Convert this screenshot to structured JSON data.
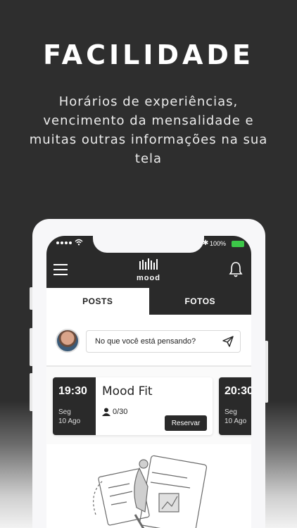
{
  "promo": {
    "headline": "FACILIDADE",
    "subtitle": "Horários de experiências, vencimento da mensalidade e muitas outras informações na sua tela"
  },
  "statusbar": {
    "battery_text": "100%",
    "battery_color": "#3cc748"
  },
  "appbar": {
    "logo_text": "mood",
    "menu_icon": "hamburger-icon",
    "notification_icon": "bell-icon"
  },
  "tabs": [
    {
      "label": "POSTS",
      "active": true
    },
    {
      "label": "FOTOS",
      "active": false
    }
  ],
  "composer": {
    "placeholder": "No que você está pensando?",
    "send_icon": "send-icon"
  },
  "classes": [
    {
      "time": "19:30",
      "day": "Seg",
      "date": "10 Ago",
      "name": "Mood Fit",
      "capacity": "0/30",
      "action": "Reservar"
    },
    {
      "time": "20:30",
      "day": "Seg",
      "date": "10 Ago"
    }
  ],
  "colors": {
    "dark": "#2a2a2a",
    "background": "#2e2e2e"
  }
}
